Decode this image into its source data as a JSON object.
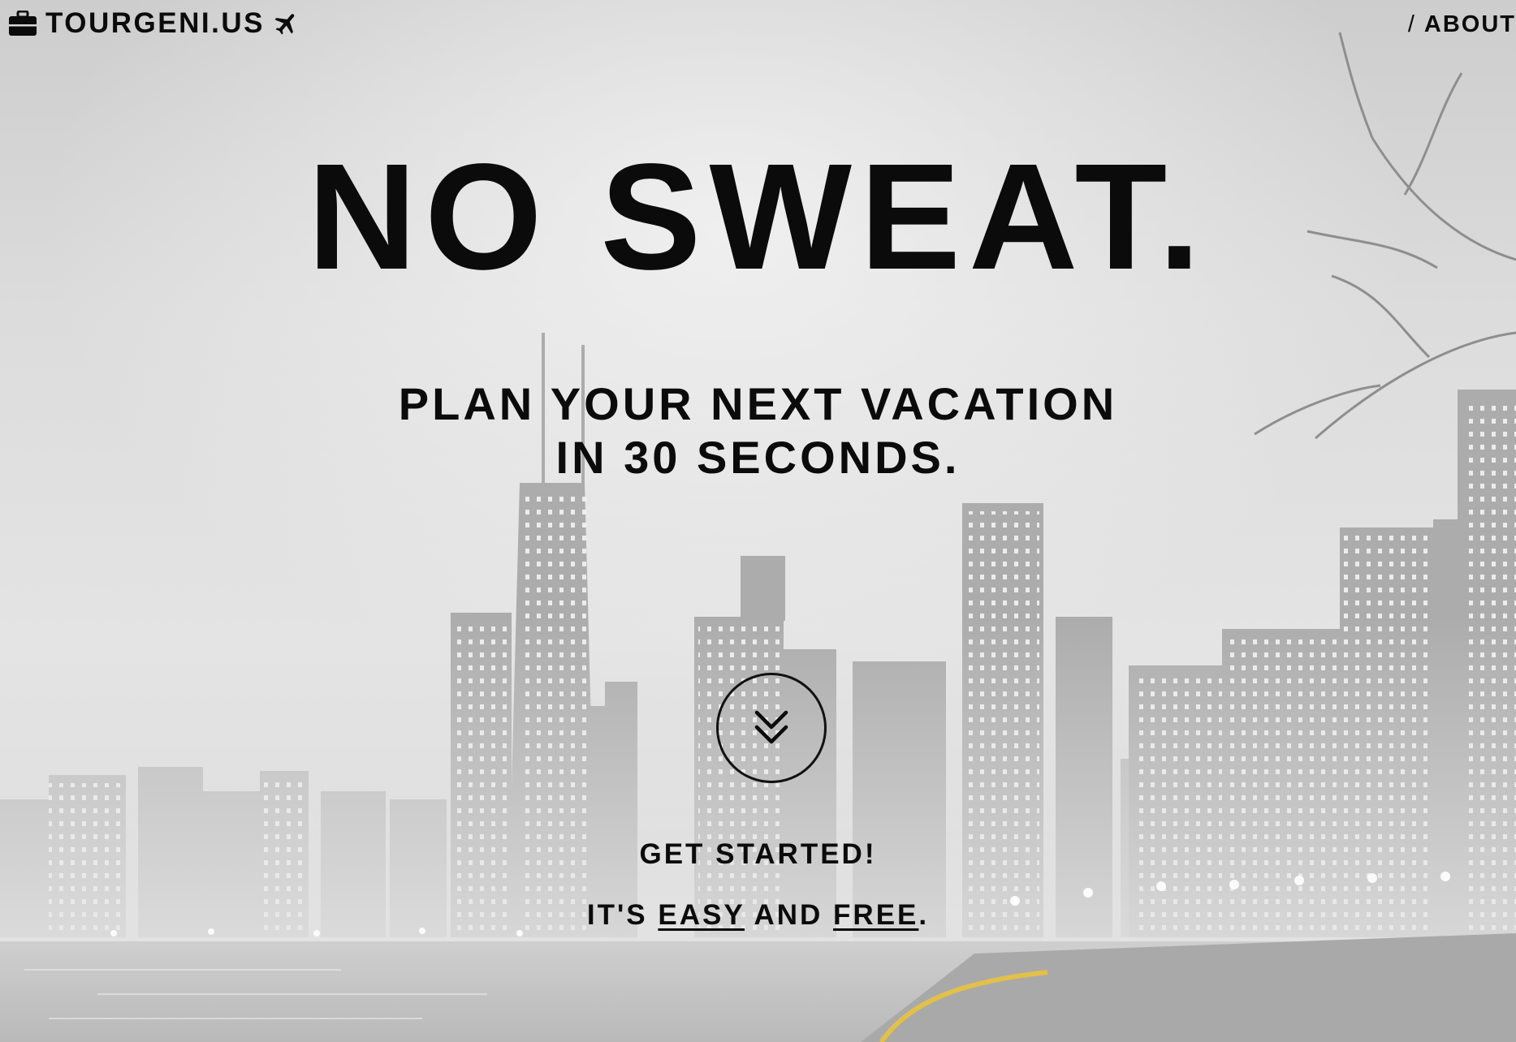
{
  "header": {
    "brand": "TOURGENI.US",
    "brand_icon": "briefcase-icon",
    "brand_icon_right": "airplane-icon",
    "nav_separator": "/",
    "nav_about": "ABOUT"
  },
  "hero": {
    "headline": "NO SWEAT.",
    "subline_1": "PLAN YOUR NEXT VACATION",
    "subline_2": "IN 30 SECONDS.",
    "cta_icon": "double-chevron-down-icon",
    "get_started": "GET STARTED!",
    "tagline_prefix": "IT'S",
    "tagline_easy": "EASY",
    "tagline_and": "AND",
    "tagline_free": "FREE",
    "tagline_end": "."
  },
  "colors": {
    "text": "#0b0b0b",
    "background": "#d6d6d6",
    "road_line": "#e2c04a"
  }
}
